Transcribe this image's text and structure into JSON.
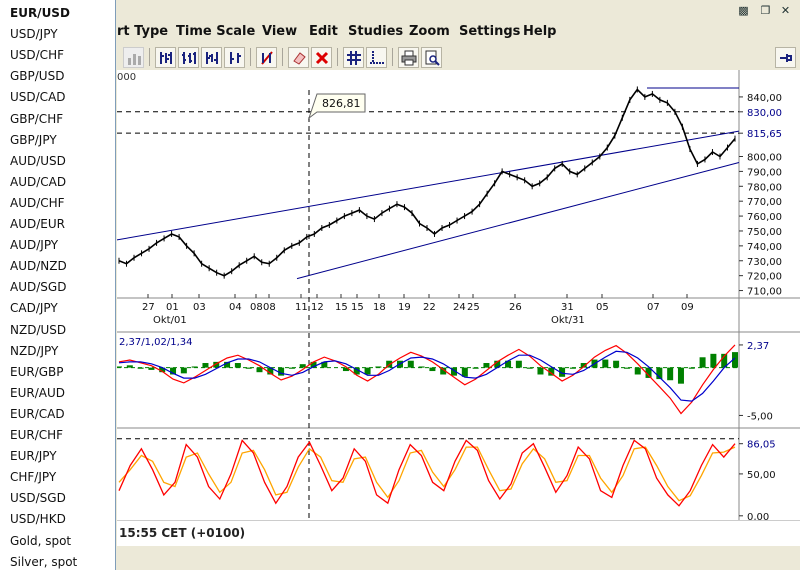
{
  "menu": [
    "rt Type",
    "Time Scale",
    "View",
    "Edit",
    "Studies",
    "Zoom",
    "Settings",
    "Help"
  ],
  "toolbar": {
    "icons": [
      "bar-chart-icon",
      "candle-chart-icon",
      "ohlc-icon",
      "ohlc-alt-icon",
      "hlc-icon",
      "trendline-icon",
      "eraser-icon",
      "delete-icon",
      "grid-icon",
      "crosshair-icon",
      "print-icon",
      "print-preview-icon",
      "pin-icon"
    ]
  },
  "symbols": [
    "EUR/USD",
    "USD/JPY",
    "USD/CHF",
    "GBP/USD",
    "USD/CAD",
    "GBP/CHF",
    "GBP/JPY",
    "AUD/USD",
    "AUD/CAD",
    "AUD/CHF",
    "AUD/EUR",
    "AUD/JPY",
    "AUD/NZD",
    "AUD/SGD",
    "CAD/JPY",
    "NZD/USD",
    "NZD/JPY",
    "EUR/GBP",
    "EUR/AUD",
    "EUR/CAD",
    "EUR/CHF",
    "EUR/JPY",
    "CHF/JPY",
    "USD/SGD",
    "USD/HKD",
    "Gold, spot",
    "Silver, spot"
  ],
  "header_value": "000",
  "status": {
    "time": "15:55  CET (+0100)"
  },
  "cursor_label": "826,81",
  "colors": {
    "accent": "#00008b",
    "bg": "#ece9d8",
    "macd_hist": "#008000",
    "stoch_k": "#ff0000",
    "stoch_d": "#ffa500"
  },
  "chart_data": [
    {
      "type": "line",
      "series": [
        {
          "values": [
            730,
            728,
            732,
            735,
            738,
            742,
            745,
            748,
            746,
            740,
            735,
            728,
            725,
            722,
            720,
            723,
            727,
            730,
            733,
            729,
            728,
            732,
            737,
            740,
            742,
            746,
            748,
            752,
            754,
            757,
            760,
            762,
            764,
            760,
            758,
            762,
            765,
            768,
            766,
            762,
            755,
            752,
            748,
            752,
            754,
            757,
            760,
            763,
            768,
            775,
            782,
            790,
            788,
            786,
            784,
            780,
            782,
            786,
            792,
            795,
            790,
            788,
            792,
            796,
            800,
            806,
            814,
            826,
            838,
            845,
            840,
            842,
            838,
            836,
            830,
            820,
            805,
            795,
            798,
            803,
            800,
            806,
            812
          ]
        }
      ],
      "x_tick_labels": [
        "27",
        "01",
        "03",
        "04",
        "08",
        "08",
        "11",
        "12",
        "15",
        "15",
        "18",
        "19",
        "22",
        "24",
        "25",
        "26",
        "31",
        "05",
        "07",
        "09"
      ],
      "x_group_labels": [
        "Okt/01",
        "Okt/31"
      ],
      "y_tick_labels": [
        "840,00",
        "830,00",
        "815,65",
        "800,00",
        "790,00",
        "780,00",
        "770,00",
        "760,00",
        "750,00",
        "740,00",
        "730,00",
        "720,00",
        "710,00"
      ],
      "ylim": [
        705,
        848
      ],
      "reference_lines": [
        830,
        815.65
      ],
      "last_value_label": "815,65"
    },
    {
      "type": "line",
      "header": "2,37/1,02/1,34",
      "series": [
        {
          "values": [
            0.6,
            0.8,
            0.5,
            0.2,
            -0.4,
            -1.2,
            -1.6,
            -1.0,
            -0.3,
            0.4,
            1.0,
            1.3,
            0.8,
            0.2,
            -0.6,
            -1.3,
            -0.9,
            -0.2,
            0.6,
            1.1,
            0.7,
            0.1,
            -0.8,
            -1.4,
            -0.7,
            0.3,
            1.0,
            1.6,
            1.2,
            0.6,
            -0.2,
            -1.0,
            -1.8,
            -1.2,
            -0.3,
            0.6,
            1.3,
            1.9,
            1.2,
            0.2,
            -0.6,
            -1.4,
            -0.8,
            0.1,
            1.1,
            1.8,
            2.3,
            1.5,
            0.4,
            -0.8,
            -2.0,
            -3.2,
            -4.8,
            -3.6,
            -1.8,
            -0.2,
            1.2,
            2.37
          ]
        },
        {
          "values": [
            0.5,
            0.6,
            0.6,
            0.4,
            0.0,
            -0.6,
            -1.1,
            -1.1,
            -0.7,
            -0.1,
            0.5,
            0.9,
            0.9,
            0.6,
            0.0,
            -0.6,
            -0.8,
            -0.5,
            0.1,
            0.6,
            0.7,
            0.4,
            -0.2,
            -0.8,
            -0.8,
            -0.3,
            0.4,
            1.0,
            1.1,
            0.9,
            0.4,
            -0.3,
            -1.0,
            -1.1,
            -0.7,
            0.0,
            0.7,
            1.3,
            1.3,
            0.8,
            0.1,
            -0.6,
            -0.7,
            -0.3,
            0.4,
            1.1,
            1.7,
            1.6,
            1.0,
            0.1,
            -1.0,
            -2.1,
            -3.4,
            -3.5,
            -2.7,
            -1.4,
            0.0,
            1.02
          ]
        }
      ],
      "y_tick_labels": [
        "2,37",
        "-5,00"
      ],
      "ylim": [
        -6,
        3.2
      ]
    },
    {
      "type": "line",
      "series": [
        {
          "values": [
            30,
            60,
            80,
            55,
            25,
            40,
            85,
            70,
            35,
            20,
            50,
            90,
            75,
            40,
            15,
            35,
            70,
            88,
            60,
            30,
            45,
            80,
            65,
            25,
            15,
            55,
            85,
            72,
            40,
            30,
            65,
            90,
            78,
            42,
            20,
            38,
            75,
            86,
            58,
            28,
            48,
            82,
            68,
            30,
            22,
            60,
            90,
            80,
            45,
            25,
            12,
            30,
            60,
            85,
            70,
            86
          ]
        },
        {
          "values": [
            40,
            55,
            72,
            65,
            40,
            35,
            70,
            75,
            50,
            28,
            40,
            75,
            78,
            55,
            25,
            28,
            58,
            80,
            70,
            42,
            40,
            68,
            70,
            40,
            22,
            42,
            75,
            78,
            52,
            35,
            55,
            82,
            82,
            55,
            30,
            32,
            62,
            80,
            68,
            40,
            42,
            72,
            72,
            45,
            28,
            48,
            80,
            82,
            60,
            35,
            18,
            24,
            48,
            75,
            76,
            82
          ]
        }
      ],
      "y_tick_labels": [
        "86,05",
        "50,00",
        "0,00"
      ],
      "ylim": [
        -5,
        100
      ],
      "reference_lines": [
        92
      ]
    }
  ]
}
